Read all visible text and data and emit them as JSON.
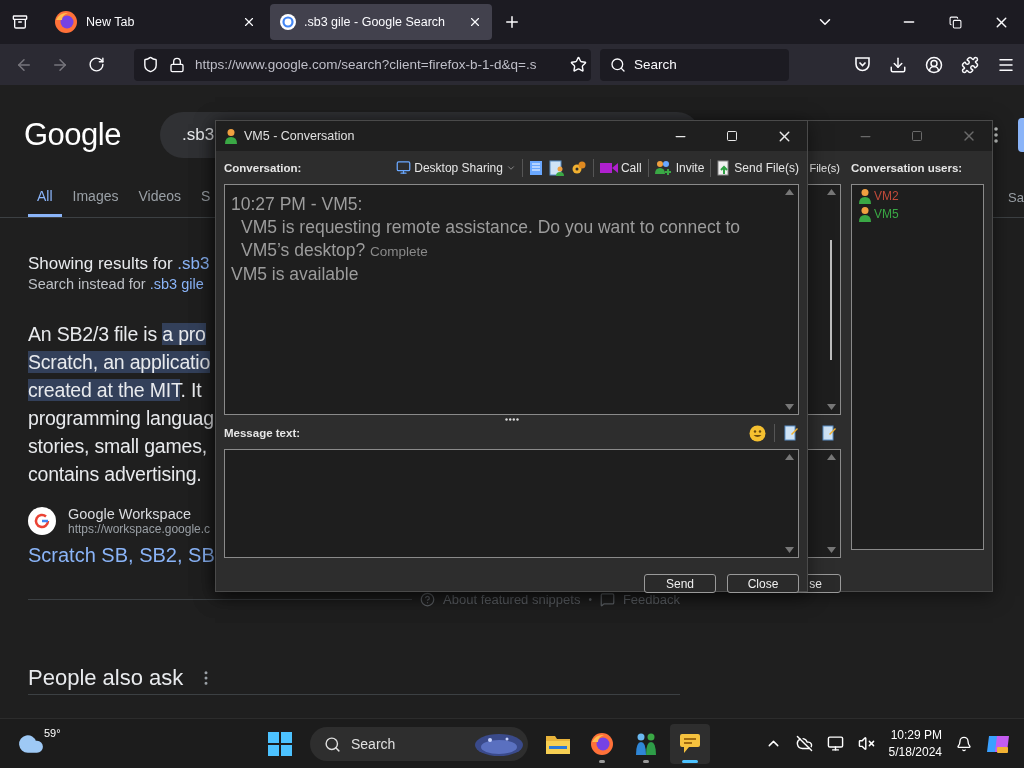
{
  "browser": {
    "tabs": [
      {
        "title": "New Tab",
        "selected": false
      },
      {
        "title": ".sb3 gile - Google Search",
        "selected": true
      }
    ],
    "url": "https://www.google.com/search?client=firefox-b-1-d&q=.s",
    "search": {
      "placeholder": "Search"
    }
  },
  "google": {
    "logo": "Google",
    "query": ".sb3",
    "nav": [
      {
        "label": "All",
        "selected": true
      },
      {
        "label": "Images",
        "selected": false
      },
      {
        "label": "Videos",
        "selected": false
      },
      {
        "label": "S",
        "selected": false
      }
    ],
    "nav_right": "Sa",
    "showing": {
      "prefix": "Showing results for",
      "term": ".sb3"
    },
    "instead": {
      "prefix": "Search instead for",
      "term": ".sb3 gile"
    },
    "answer_lines": [
      {
        "parts": [
          {
            "text": "An SB2/3 file is ",
            "highlighted": false
          },
          {
            "text": "a pro",
            "highlighted": true
          }
        ]
      },
      {
        "parts": [
          {
            "text": "Scratch, an applicatio",
            "highlighted": true
          }
        ]
      },
      {
        "parts": [
          {
            "text": "created at the MIT",
            "highlighted": true
          },
          {
            "text": ". It",
            "highlighted": false
          }
        ]
      },
      {
        "parts": [
          {
            "text": "programming languag",
            "highlighted": false
          }
        ]
      },
      {
        "parts": [
          {
            "text": "stories, small games,",
            "highlighted": false
          }
        ]
      },
      {
        "parts": [
          {
            "text": "contains advertising.",
            "highlighted": false
          }
        ]
      }
    ],
    "source": {
      "name": "Google Workspace",
      "url": "https://workspace.google.c"
    },
    "result_title": "Scratch SB, SB2, SB",
    "snippet_footer": {
      "about": "About featured snippets",
      "separator": "•",
      "feedback": "Feedback"
    },
    "people_also_ask": "People also ask"
  },
  "back_window": {
    "toolbar_text": "File(s)",
    "users_label": "Conversation users:",
    "users": [
      {
        "name": "VM2",
        "color": "#c04a3a"
      },
      {
        "name": "VM5",
        "color": "#3aa845"
      }
    ],
    "button": "se"
  },
  "conversation": {
    "title": "VM5 - Conversation",
    "label": "Conversation:",
    "desktop_sharing": "Desktop Sharing",
    "call": "Call",
    "invite": "Invite",
    "send_files": "Send File(s)",
    "messages": [
      {
        "kind": "message",
        "header": "10:27 PM - VM5:",
        "text": "VM5 is requesting remote assistance. Do you want to connect to VM5’s desktop?",
        "status": "Complete"
      },
      {
        "kind": "notice",
        "text": "VM5 is available"
      }
    ],
    "message_label": "Message text:",
    "buttons": [
      "Send",
      "Close"
    ]
  },
  "taskbar": {
    "weather": "59°",
    "search": {
      "placeholder": "Search"
    },
    "apps": [
      {
        "kind": "explorer",
        "running": false,
        "active": false
      },
      {
        "kind": "firefox",
        "running": true,
        "active": false
      },
      {
        "kind": "people",
        "running": true,
        "active": false
      },
      {
        "kind": "chat",
        "running": true,
        "active": true
      }
    ],
    "time": "10:29 PM",
    "date": "5/18/2024"
  }
}
